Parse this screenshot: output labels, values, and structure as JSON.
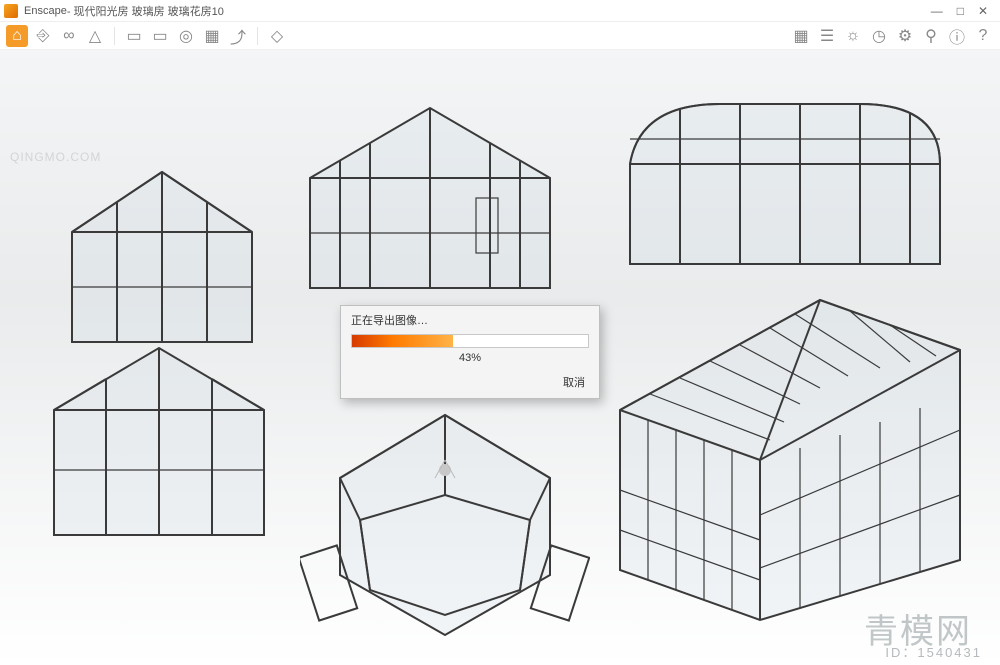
{
  "window": {
    "app_name": "Enscape",
    "title_suffix": " - 现代阳光房 玻璃房 玻璃花房10",
    "controls": {
      "min": "—",
      "max": "□",
      "close": "✕"
    }
  },
  "toolbar": {
    "left": [
      {
        "name": "home-icon",
        "glyph": "⌂",
        "home": true
      },
      {
        "name": "link-icon",
        "glyph": "⎆"
      },
      {
        "name": "vr-icon",
        "glyph": "∞"
      },
      {
        "name": "alert-icon",
        "glyph": "△"
      },
      {
        "sep": true
      },
      {
        "name": "doc-icon",
        "glyph": "▭"
      },
      {
        "name": "video-icon",
        "glyph": "▭"
      },
      {
        "name": "panorama-icon",
        "glyph": "◎"
      },
      {
        "name": "export-icon",
        "glyph": "▦"
      },
      {
        "name": "upload-icon",
        "glyph": "⤴"
      },
      {
        "sep": true
      },
      {
        "name": "tag-icon",
        "glyph": "◇"
      }
    ],
    "right": [
      {
        "name": "grid-icon",
        "glyph": "▦"
      },
      {
        "name": "layers-icon",
        "glyph": "☰"
      },
      {
        "name": "light-icon",
        "glyph": "☼"
      },
      {
        "name": "clock-icon",
        "glyph": "◷"
      },
      {
        "name": "settings-icon",
        "glyph": "⚙"
      },
      {
        "name": "pin-icon",
        "glyph": "⚲"
      },
      {
        "name": "info-icon",
        "glyph": "ⓘ"
      },
      {
        "name": "help-icon",
        "glyph": "?"
      }
    ]
  },
  "dialog": {
    "title": "正在导出图像…",
    "percent_value": 43,
    "percent_label": "43%",
    "cancel": "取消"
  },
  "watermarks": {
    "top_left": "QINGMO.COM",
    "brand": "青模网",
    "id_prefix": "ID：",
    "id_value": "1540431"
  }
}
